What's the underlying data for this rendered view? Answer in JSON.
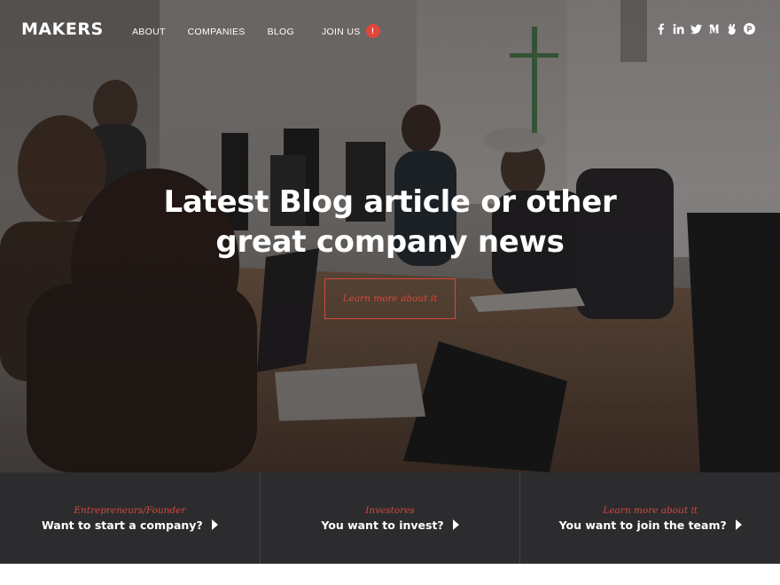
{
  "brand": {
    "logo_text": "MAKERS"
  },
  "nav": {
    "items": [
      {
        "label": "ABOUT"
      },
      {
        "label": "COMPANIES"
      },
      {
        "label": "BLOG"
      },
      {
        "label": "JOIN US"
      }
    ],
    "join_badge": "!"
  },
  "social": {
    "icons": [
      "facebook-icon",
      "linkedin-icon",
      "twitter-icon",
      "medium-icon",
      "angellist-icon",
      "producthunt-icon"
    ]
  },
  "hero": {
    "headline_line1": "Latest Blog article or other",
    "headline_line2": "great company news",
    "cta_label": "Learn more about it"
  },
  "cards": [
    {
      "subtitle": "Entrepreneurs/Founder",
      "title": "Want to start a company?"
    },
    {
      "subtitle": "Investores",
      "title": "You want to invest?"
    },
    {
      "subtitle": "Learn more about it",
      "title": "You want to join the team?"
    }
  ],
  "colors": {
    "accent": "#d8483c",
    "badge": "#e2453a",
    "cards_bg": "#2c2c2e",
    "text": "#ffffff"
  }
}
